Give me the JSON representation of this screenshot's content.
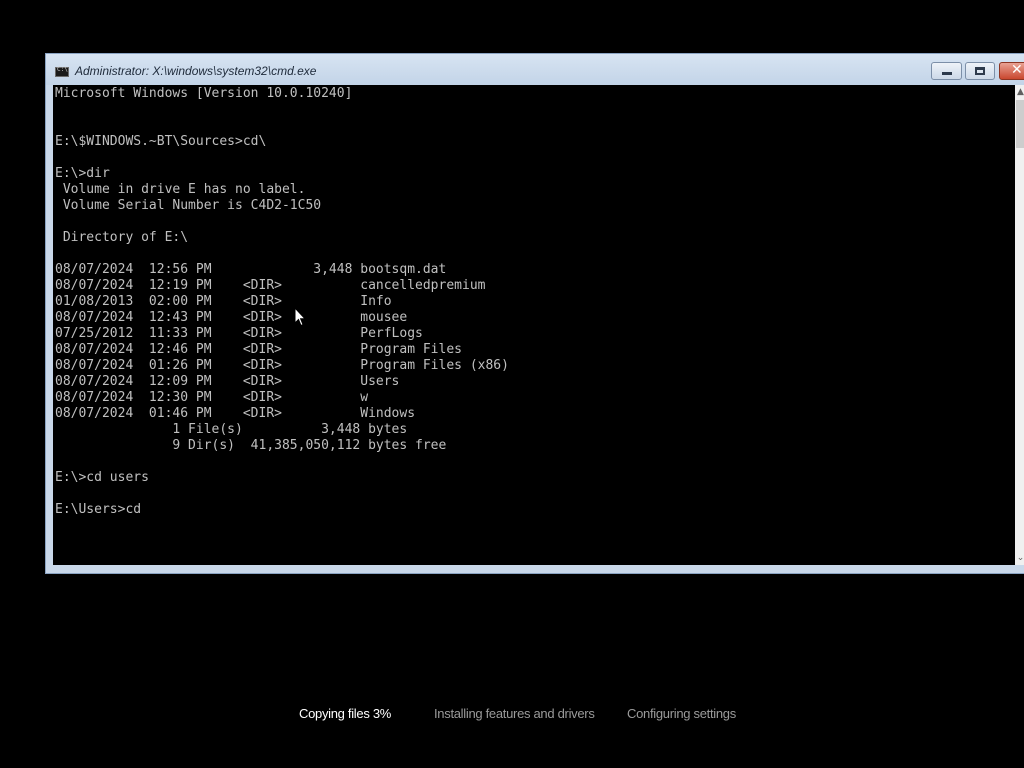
{
  "window": {
    "title": "Administrator: X:\\windows\\system32\\cmd.exe",
    "icon": "cmd-icon"
  },
  "console": {
    "lines": [
      "Microsoft Windows [Version 10.0.10240]",
      "",
      "",
      "E:\\$WINDOWS.~BT\\Sources>cd\\",
      "",
      "E:\\>dir",
      " Volume in drive E has no label.",
      " Volume Serial Number is C4D2-1C50",
      "",
      " Directory of E:\\",
      "",
      "08/07/2024  12:56 PM             3,448 bootsqm.dat",
      "08/07/2024  12:19 PM    <DIR>          cancelledpremium",
      "01/08/2013  02:00 PM    <DIR>          Info",
      "08/07/2024  12:43 PM    <DIR>          mousee",
      "07/25/2012  11:33 PM    <DIR>          PerfLogs",
      "08/07/2024  12:46 PM    <DIR>          Program Files",
      "08/07/2024  01:26 PM    <DIR>          Program Files (x86)",
      "08/07/2024  12:09 PM    <DIR>          Users",
      "08/07/2024  12:30 PM    <DIR>          w",
      "08/07/2024  01:46 PM    <DIR>          Windows",
      "               1 File(s)          3,448 bytes",
      "               9 Dir(s)  41,385,050,112 bytes free",
      "",
      "E:\\>cd users",
      "",
      "E:\\Users>cd"
    ]
  },
  "setup": {
    "steps": [
      {
        "label": "Copying files 3%",
        "state": "active"
      },
      {
        "label": "Installing features and drivers",
        "state": "pending"
      },
      {
        "label": "Configuring settings",
        "state": "pending"
      }
    ],
    "progress_percent": 3
  },
  "colors": {
    "console_background": "#000000",
    "console_text": "#c0c0c0",
    "active_step": "#ffffff",
    "pending_step": "#9a9a9a"
  }
}
